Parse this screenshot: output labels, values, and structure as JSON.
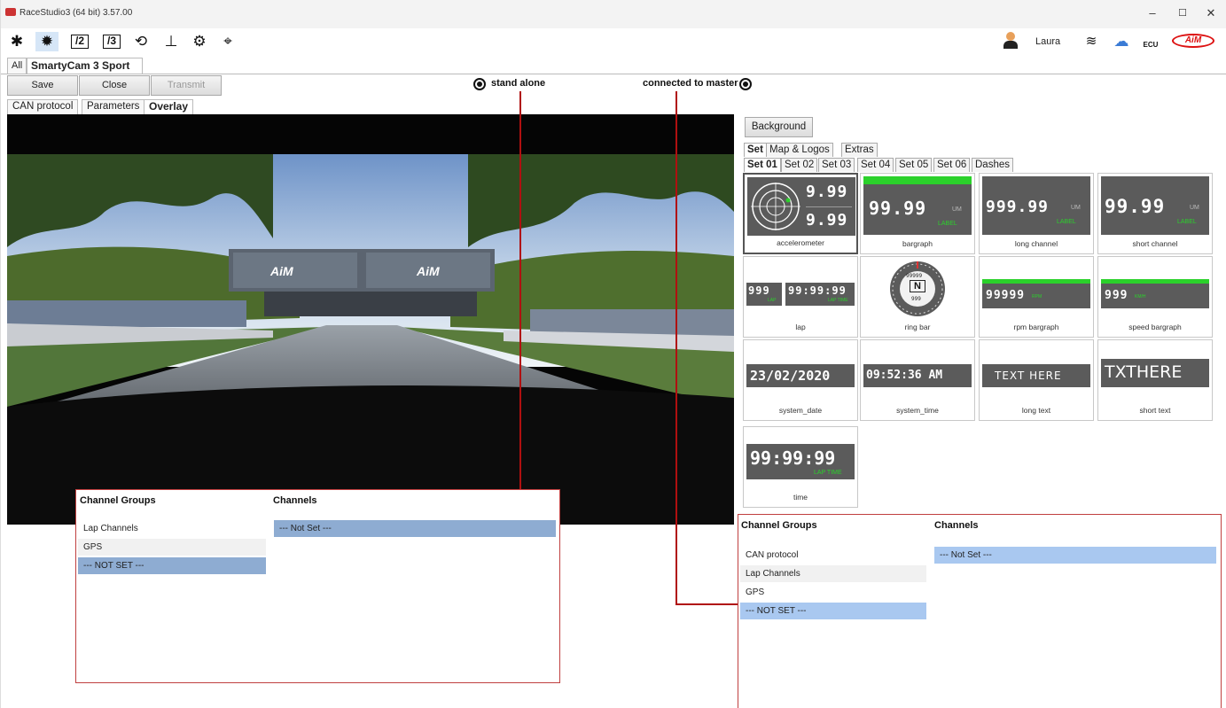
{
  "window": {
    "title": "RaceStudio3 (64 bit) 3.57.00",
    "min": "–",
    "max": "☐",
    "close": "✕"
  },
  "toolbar": {
    "user_name": "Laura"
  },
  "doc_tabs": {
    "all": "All",
    "device": "SmartyCam 3 Sport",
    "device_close": "✕"
  },
  "buttons": {
    "save": "Save",
    "close": "Close",
    "transmit": "Transmit"
  },
  "sub_tabs": {
    "can": "CAN protocol",
    "parameters": "Parameters",
    "overlay": "Overlay"
  },
  "annotations": {
    "stand_alone": "stand alone",
    "connected": "connected to master"
  },
  "video": {
    "banner_logo": "AiM"
  },
  "right_panel": {
    "background_button": "Background",
    "tabs": [
      "Set",
      "Map & Logos",
      "Extras"
    ],
    "set_tabs": [
      "Set 01",
      "Set 02",
      "Set 03",
      "Set 04",
      "Set 05",
      "Set 06",
      "Dashes"
    ],
    "tiles": {
      "accelerometer": {
        "v1": "9.99",
        "v2": "9.99",
        "caption": "accelerometer"
      },
      "bargraph": {
        "value": "99.99",
        "um": "UM",
        "label": "LABEL",
        "caption": "bargraph"
      },
      "long_channel": {
        "value": "999.99",
        "um": "UM",
        "label": "LABEL",
        "caption": "long channel"
      },
      "short_channel": {
        "value": "99.99",
        "um": "UM",
        "label": "LABEL",
        "caption": "short channel"
      },
      "lap": {
        "lap": "999",
        "lap_lbl": "LAP",
        "time": "99:99:99",
        "time_lbl": "LAP TIME",
        "caption": "lap"
      },
      "ring_bar": {
        "top": "99999",
        "letter": "N",
        "bottom": "999",
        "caption": "ring bar"
      },
      "rpm_bargraph": {
        "value": "99999",
        "um": "RPM",
        "caption": "rpm bargraph"
      },
      "speed_bargraph": {
        "value": "999",
        "um": "KM/H",
        "caption": "speed bargraph"
      },
      "system_date": {
        "value": "23/02/2020",
        "caption": "system_date"
      },
      "system_time": {
        "value": "09:52:36 AM",
        "caption": "system_time"
      },
      "long_text": {
        "value": "TEXT HERE",
        "caption": "long text"
      },
      "short_text": {
        "value": "TXTHERE",
        "caption": "short text"
      },
      "time": {
        "value": "99:99:99",
        "label": "LAP TIME",
        "caption": "time"
      }
    }
  },
  "channels_standalone": {
    "groups_header": "Channel Groups",
    "channels_header": "Channels",
    "groups": [
      "Lap Channels",
      "GPS",
      "--- NOT SET ---"
    ],
    "channels": [
      "--- Not Set ---"
    ]
  },
  "channels_master": {
    "groups_header": "Channel Groups",
    "channels_header": "Channels",
    "groups": [
      "CAN protocol",
      "Lap Channels",
      "GPS",
      "--- NOT SET ---"
    ],
    "channels": [
      "--- Not Set ---"
    ]
  },
  "colors": {
    "accent_green": "#2bd12b",
    "select_blue": "#a9c8f0",
    "annotation_red": "#b01010"
  }
}
